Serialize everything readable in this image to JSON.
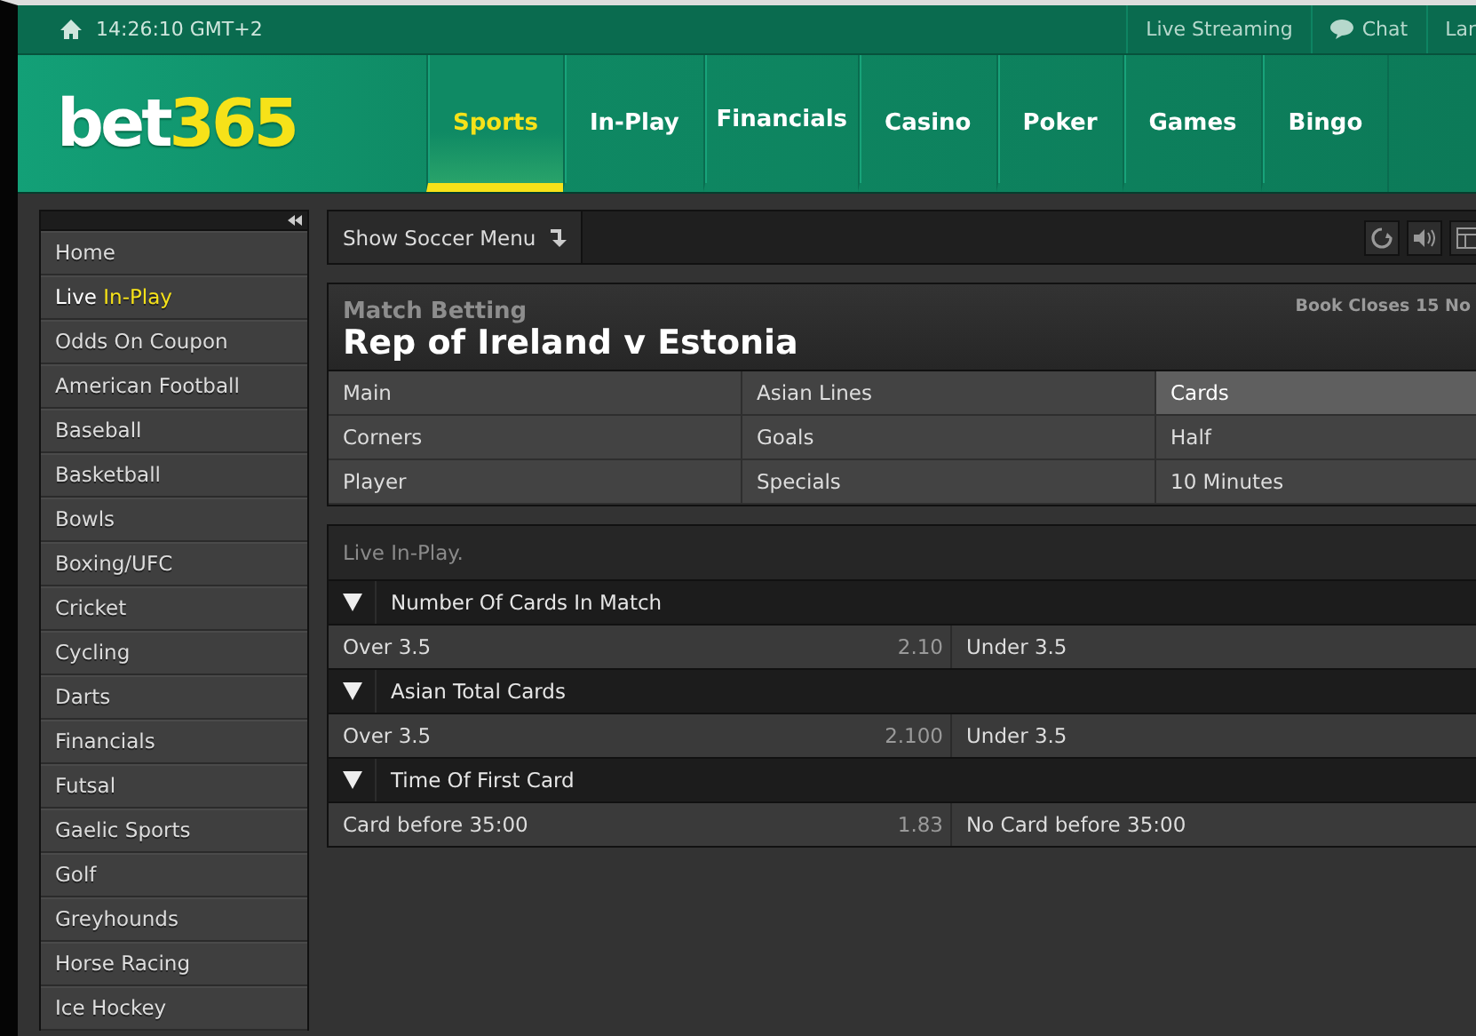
{
  "top_bar": {
    "clock": "14:26:10 GMT+2",
    "links": [
      "Live Streaming",
      "Chat",
      "Lar"
    ]
  },
  "header": {
    "logo": {
      "word": "bet",
      "number": "365"
    },
    "nav": [
      {
        "label": "Sports",
        "selected": true
      },
      {
        "label": "In-Play",
        "selected": false
      },
      {
        "label": "Financials",
        "selected": false
      },
      {
        "label": "Casino",
        "selected": false
      },
      {
        "label": "Poker",
        "selected": false
      },
      {
        "label": "Games",
        "selected": false
      },
      {
        "label": "Bingo",
        "selected": false
      }
    ]
  },
  "sidebar": {
    "items": [
      {
        "label": "Home"
      },
      {
        "label": "Live",
        "highlight": "In-Play"
      },
      {
        "label": "Odds On Coupon"
      },
      {
        "label": "American Football"
      },
      {
        "label": "Baseball"
      },
      {
        "label": "Basketball"
      },
      {
        "label": "Bowls"
      },
      {
        "label": "Boxing/UFC"
      },
      {
        "label": "Cricket"
      },
      {
        "label": "Cycling"
      },
      {
        "label": "Darts"
      },
      {
        "label": "Financials"
      },
      {
        "label": "Futsal"
      },
      {
        "label": "Gaelic Sports"
      },
      {
        "label": "Golf"
      },
      {
        "label": "Greyhounds"
      },
      {
        "label": "Horse Racing"
      },
      {
        "label": "Ice Hockey"
      }
    ]
  },
  "toolbar": {
    "menu_button": "Show Soccer Menu"
  },
  "match": {
    "category": "Match Betting",
    "title": "Rep of Ireland v Estonia",
    "book_closes": "Book Closes 15 No",
    "market_tabs": [
      {
        "label": "Main",
        "selected": false
      },
      {
        "label": "Asian Lines",
        "selected": false
      },
      {
        "label": "Cards",
        "selected": true
      },
      {
        "label": "Corners",
        "selected": false
      },
      {
        "label": "Goals",
        "selected": false
      },
      {
        "label": "Half",
        "selected": false
      },
      {
        "label": "Player",
        "selected": false
      },
      {
        "label": "Specials",
        "selected": false
      },
      {
        "label": "10 Minutes",
        "selected": false
      }
    ]
  },
  "live": {
    "heading": "Live In-Play.",
    "markets": [
      {
        "name": "Number Of Cards In Match",
        "expanded": true,
        "left": "Over 3.5",
        "odds": "2.10",
        "right": "Under 3.5"
      },
      {
        "name": "Asian Total Cards",
        "expanded": true,
        "left": "Over 3.5",
        "odds": "2.100",
        "right": "Under 3.5"
      },
      {
        "name": "Time Of First Card",
        "expanded": true,
        "left": "Card before 35:00",
        "odds": "1.83",
        "right": "No Card before 35:00"
      }
    ]
  }
}
